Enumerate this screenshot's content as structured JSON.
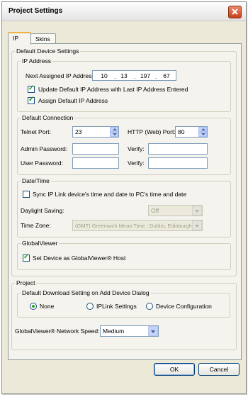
{
  "window": {
    "title": "Project Settings"
  },
  "tabs": [
    {
      "label": "IP"
    },
    {
      "label": "Skins"
    }
  ],
  "default_device": {
    "legend": "Default Device Settings",
    "ip_address": {
      "legend": "IP Address",
      "next_label": "Next Assigned IP Address:",
      "octets": [
        "10",
        "13",
        "197",
        "67"
      ],
      "update_label": "Update Default IP Address with Last IP Address Entered",
      "update_checked": true,
      "assign_label": "Assign Default IP Address",
      "assign_checked": true
    },
    "connection": {
      "legend": "Default Connection",
      "telnet_label": "Telnet Port:",
      "telnet_value": "23",
      "http_label": "HTTP (Web) Port:",
      "http_value": "80",
      "admin_label": "Admin Password:",
      "user_label": "User Password:",
      "verify_label": "Verify:"
    },
    "datetime": {
      "legend": "Date/Time",
      "sync_label": "Sync IP Link device's time and date to PC's time and date",
      "sync_checked": false,
      "daylight_label": "Daylight Saving:",
      "daylight_value": "Off",
      "timezone_label": "Time Zone:",
      "timezone_value": "(GMT) Greenwich Mean Time : Dublin, Edinburgh"
    },
    "globalviewer": {
      "legend": "GlobalViewer",
      "host_label": "Set Device as GlobalViewer® Host",
      "host_checked": true
    }
  },
  "project": {
    "legend": "Project",
    "download": {
      "legend": "Default Download Setting on Add Device Dialog",
      "options": [
        "None",
        "IPLink Settings",
        "Device Configuration"
      ],
      "selected": "None"
    },
    "speed_label": "GlobalViewer® Network Speed:",
    "speed_value": "Medium"
  },
  "buttons": {
    "ok": "OK",
    "cancel": "Cancel"
  },
  "colors": {
    "dialog_bg": "#ece9d8",
    "tab_accent": "#f1b343",
    "check_green": "#21a121"
  }
}
